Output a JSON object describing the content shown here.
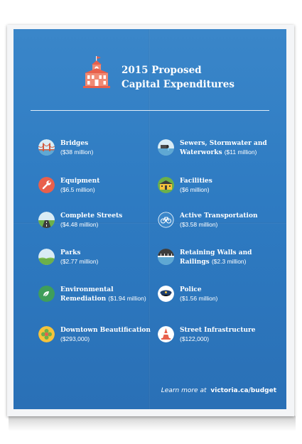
{
  "header": {
    "title_line1": "2015 Proposed",
    "title_line2": "Capital Expenditures"
  },
  "items_left": [
    {
      "name": "Bridges",
      "amount": "($38 million)",
      "icon": "bridge-icon"
    },
    {
      "name": "Equipment",
      "amount": "($6.5 million)",
      "icon": "wrench-icon"
    },
    {
      "name": "Complete Streets",
      "amount": "($4.48 million)",
      "icon": "road-icon"
    },
    {
      "name": "Parks",
      "amount": "($2.77 million)",
      "icon": "park-icon"
    },
    {
      "name_line1": "Environmental",
      "name_line2": "Remediation",
      "amount": "($1.94 million)",
      "icon": "leaf-icon"
    },
    {
      "name": "Downtown Beautification",
      "amount": "($293,000)",
      "icon": "flower-icon"
    }
  ],
  "items_right": [
    {
      "name_line1": "Sewers, Stormwater and",
      "name_line2": "Waterworks",
      "amount": "($11 million)",
      "icon": "sewer-pipe-icon"
    },
    {
      "name": "Facilities",
      "amount": "($6 million)",
      "icon": "facility-icon"
    },
    {
      "name": "Active Transportation",
      "amount": "($3.58 million)",
      "icon": "bicycle-icon"
    },
    {
      "name_line1": "Retaining Walls and",
      "name_line2": "Railings",
      "amount": "($2.3 million)",
      "icon": "retaining-wall-icon"
    },
    {
      "name": "Police",
      "amount": "($1.56 million)",
      "icon": "police-cap-icon"
    },
    {
      "name": "Street Infrastructure",
      "amount": "($122,000)",
      "icon": "traffic-cone-icon"
    }
  ],
  "footer": {
    "prefix": "Learn more at",
    "url": "victoria.ca/budget"
  },
  "colors": {
    "poster_blue": "#2e7bc2",
    "building_red": "#e8604c",
    "icon_bg": "#d9ecf5"
  }
}
